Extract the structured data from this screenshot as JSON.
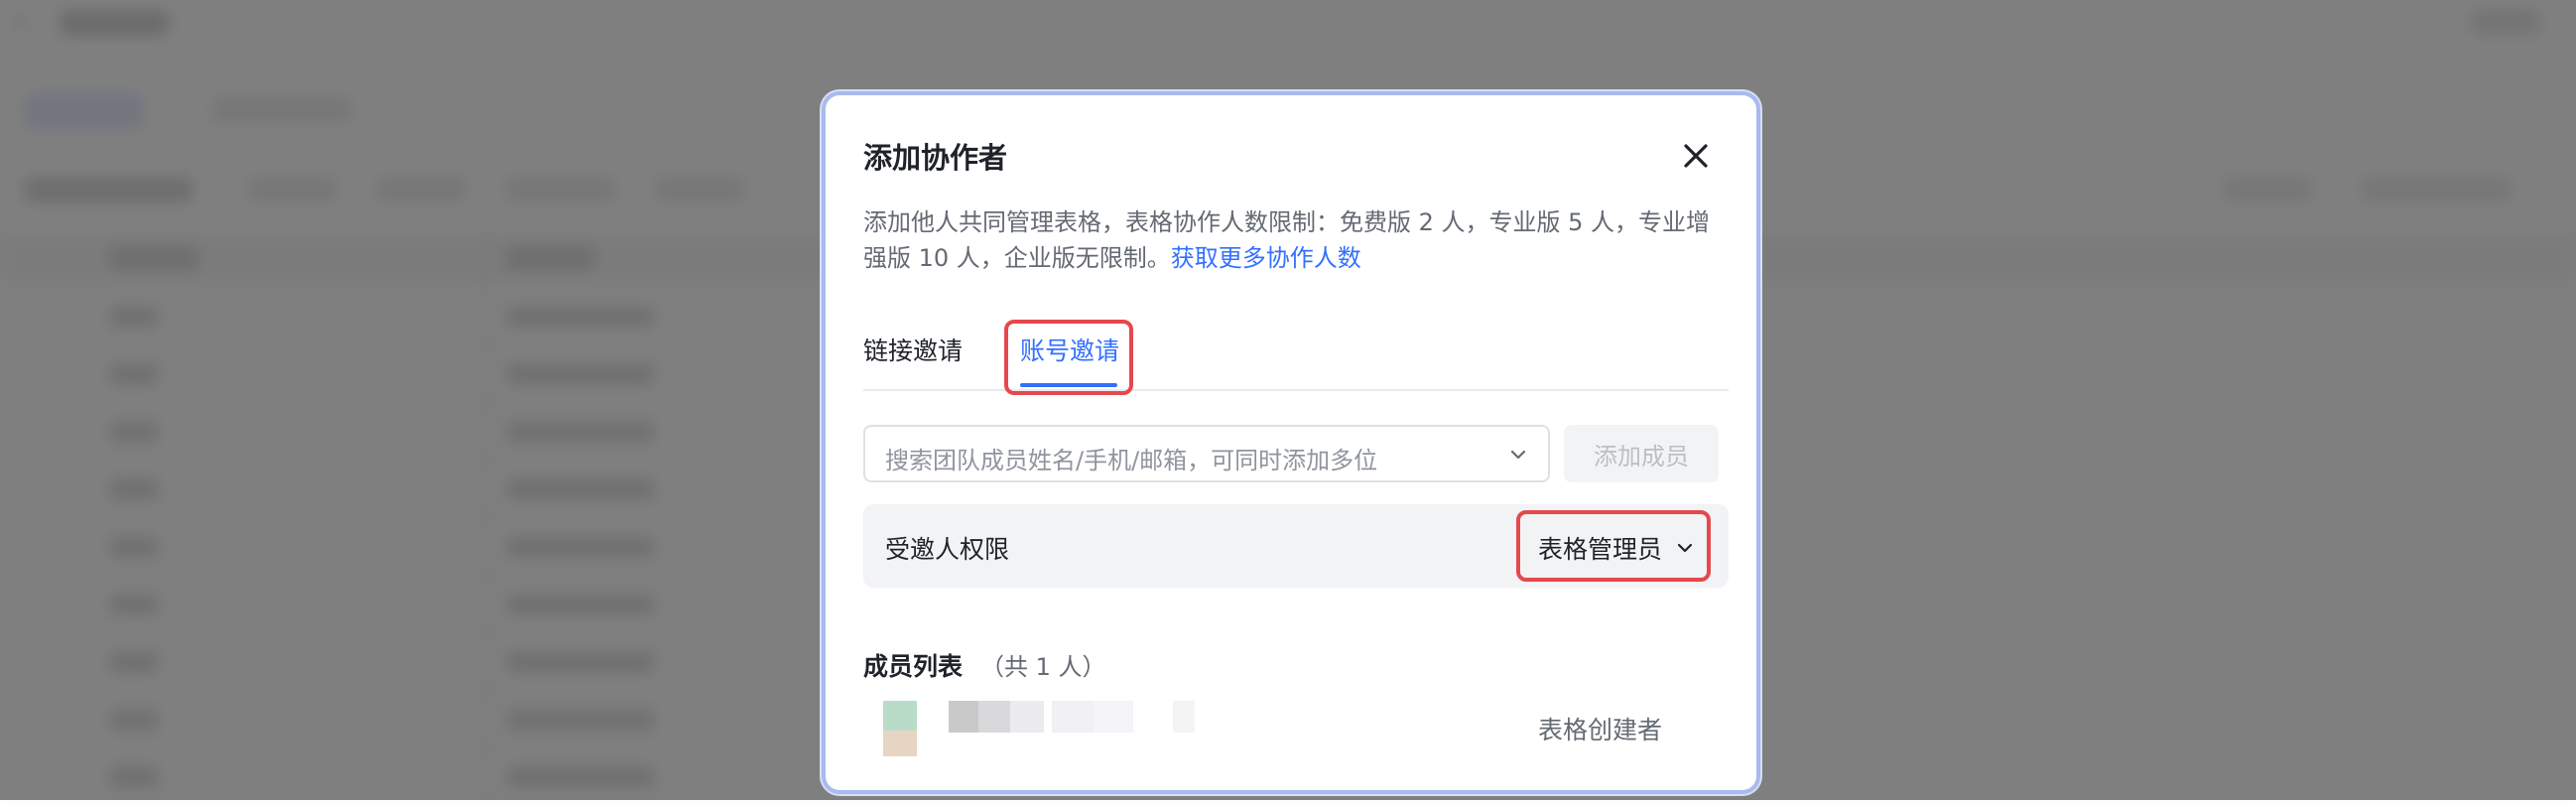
{
  "dialog": {
    "title": "添加协作者",
    "description": "添加他人共同管理表格，表格协作人数限制：免费版 2 人，专业版 5 人，专业增强版 10 人，企业版无限制。",
    "description_link": "获取更多协作人数",
    "tabs": [
      {
        "label": "链接邀请",
        "active": false
      },
      {
        "label": "账号邀请",
        "active": true
      }
    ],
    "search": {
      "placeholder": "搜索团队成员姓名/手机/邮箱，可同时添加多位"
    },
    "add_button": "添加成员",
    "permission": {
      "label": "受邀人权限",
      "value": "表格管理员"
    },
    "member_list": {
      "title": "成员列表",
      "count_text": "（共 1 人）",
      "members": [
        {
          "role": "表格创建者"
        }
      ]
    }
  },
  "colors": {
    "accent": "#3370ff",
    "highlight": "#e5484d",
    "overlay": "rgba(0,0,0,0.5)"
  }
}
